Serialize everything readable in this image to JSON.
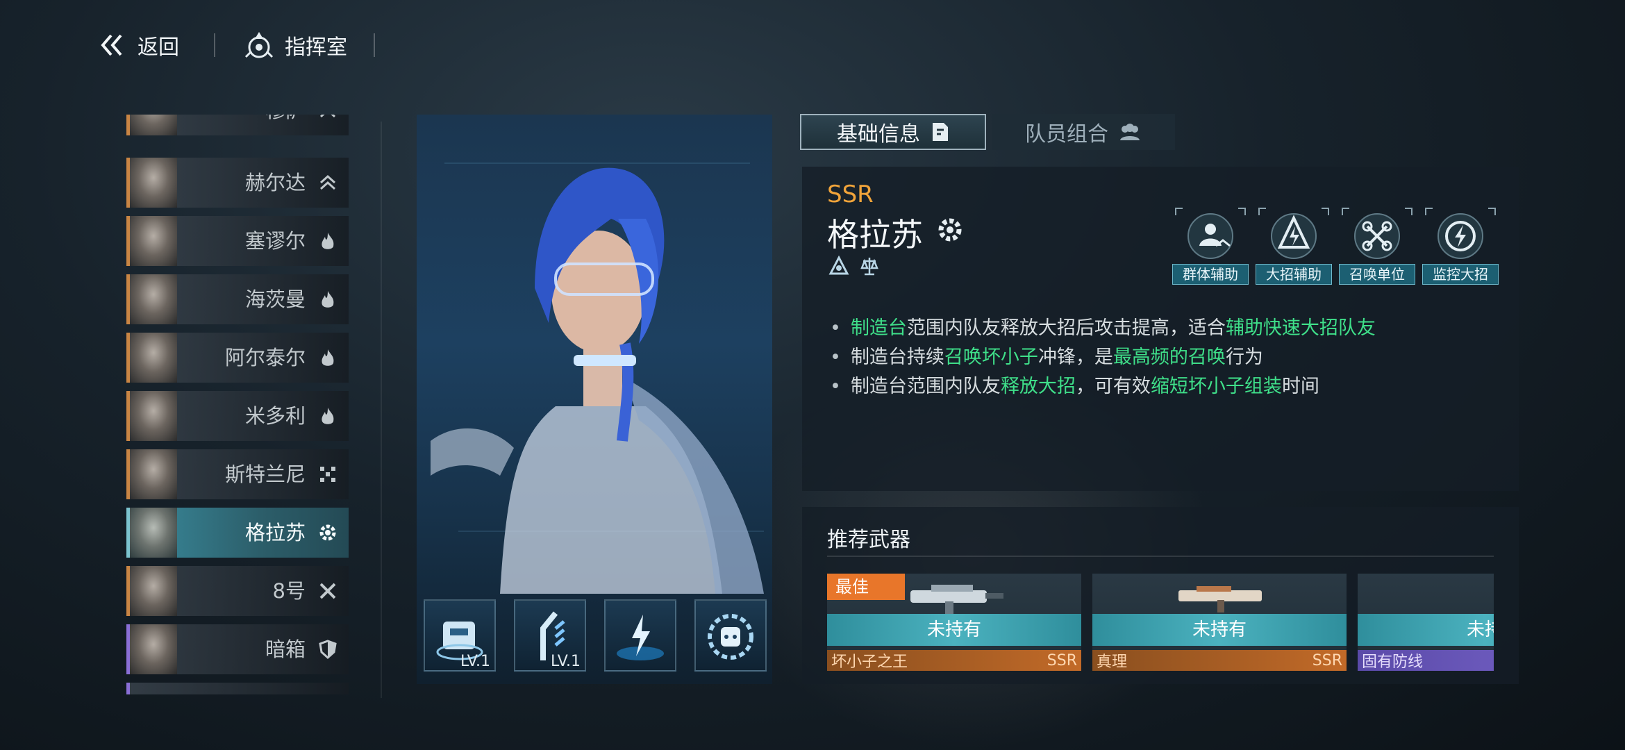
{
  "header": {
    "back_label": "返回",
    "room_label": "指挥室"
  },
  "characters": [
    {
      "name": "穆萨",
      "rarity_color": "orange",
      "class_icon": "chevron-up-icon"
    },
    {
      "name": "赫尔达",
      "rarity_color": "orange",
      "class_icon": "chevron-up-icon"
    },
    {
      "name": "塞谬尔",
      "rarity_color": "orange",
      "class_icon": "flame-icon"
    },
    {
      "name": "海茨曼",
      "rarity_color": "orange",
      "class_icon": "flame-icon"
    },
    {
      "name": "阿尔泰尔",
      "rarity_color": "orange",
      "class_icon": "flame-icon"
    },
    {
      "name": "米多利",
      "rarity_color": "orange",
      "class_icon": "flame-icon"
    },
    {
      "name": "斯特兰尼",
      "rarity_color": "orange",
      "class_icon": "grid-icon"
    },
    {
      "name": "格拉苏",
      "rarity_color": "orange",
      "class_icon": "gear-icon",
      "selected": true
    },
    {
      "name": "8号",
      "rarity_color": "orange",
      "class_icon": "cross-tools-icon"
    },
    {
      "name": "暗箱",
      "rarity_color": "purple",
      "class_icon": "shield-icon"
    }
  ],
  "skills": [
    {
      "icon": "workbench-skill-icon",
      "level": "LV.1"
    },
    {
      "icon": "robot-arm-skill-icon",
      "level": "LV.1"
    },
    {
      "icon": "lightning-skill-icon",
      "level": ""
    },
    {
      "icon": "gear-drone-skill-icon",
      "level": ""
    }
  ],
  "tabs": {
    "basic": "基础信息",
    "team": "队员组合"
  },
  "info": {
    "rarity": "SSR",
    "name": "格拉苏",
    "tags": [
      "群体辅助",
      "大招辅助",
      "召唤单位",
      "监控大招"
    ],
    "desc": [
      {
        "p1": "制造台",
        "p2": "范围内队友释放大招后攻击提高，适合",
        "p3": "辅助快速大招队友",
        "p4": "",
        "p5": ""
      },
      {
        "p1": "制造台持续",
        "p2": "召唤坏小子",
        "p3": "冲锋，是",
        "p4": "最高频的召唤",
        "p5": "行为"
      },
      {
        "p1": "制造台范围内队友",
        "p2": "释放大招",
        "p3": "，可有效",
        "p4": "缩短坏小子组装",
        "p5": "时间"
      }
    ]
  },
  "weapons": {
    "title": "推荐武器",
    "items": [
      {
        "best": "最佳",
        "status": "未持有",
        "name": "坏小子之王",
        "rarity": "SSR",
        "color": "#c26a28"
      },
      {
        "best": "",
        "status": "未持有",
        "name": "真理",
        "rarity": "SSR",
        "color": "#c26a28"
      },
      {
        "best": "",
        "status": "未持",
        "name": "固有防线",
        "rarity": "",
        "color": "#7a66cc"
      }
    ]
  },
  "colors": {
    "accent_green": "#3fe08a",
    "rarity_gold": "#f1a43a",
    "selected_teal": "#3b8ea0"
  }
}
